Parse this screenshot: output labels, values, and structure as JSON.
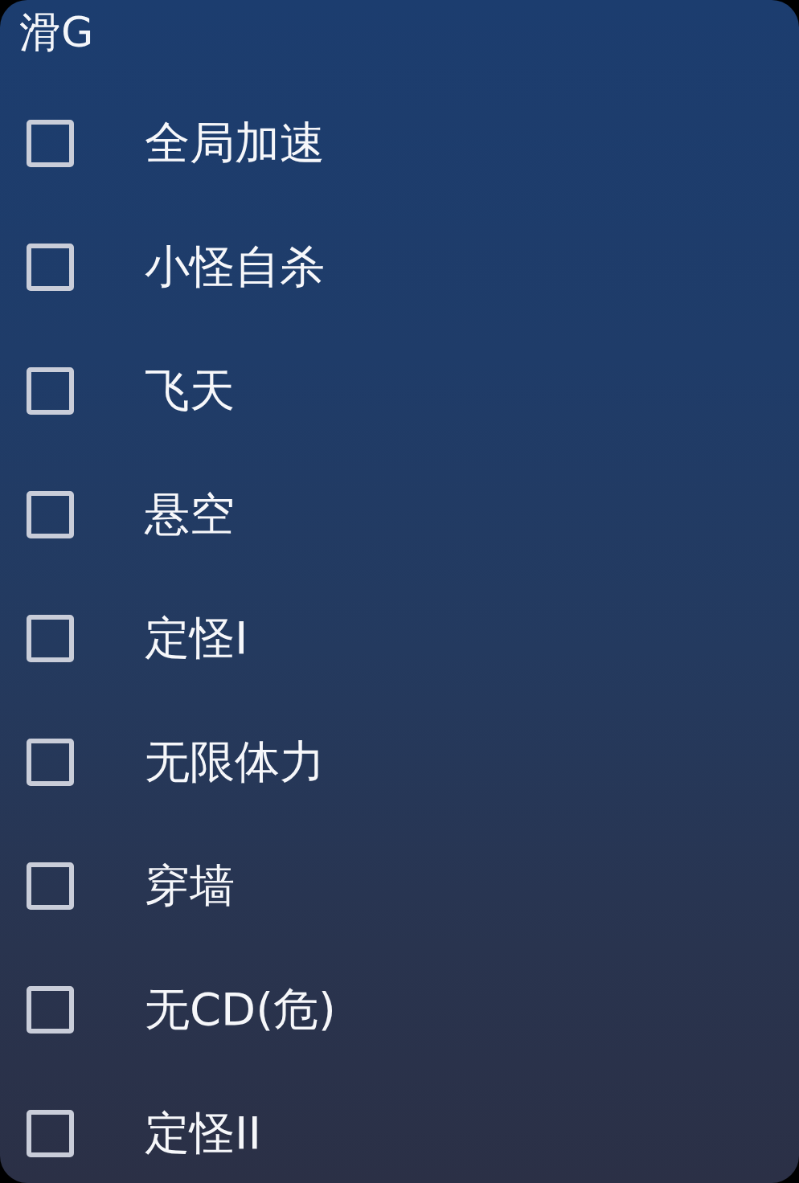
{
  "panel": {
    "title": "滑G"
  },
  "items": [
    {
      "label": "全局加速",
      "checked": false
    },
    {
      "label": "小怪自杀",
      "checked": false
    },
    {
      "label": "飞天",
      "checked": false
    },
    {
      "label": "悬空",
      "checked": false
    },
    {
      "label": "定怪I",
      "checked": false
    },
    {
      "label": "无限体力",
      "checked": false
    },
    {
      "label": "穿墙",
      "checked": false
    },
    {
      "label": "无CD(危)",
      "checked": false
    },
    {
      "label": "定怪II",
      "checked": false
    }
  ]
}
